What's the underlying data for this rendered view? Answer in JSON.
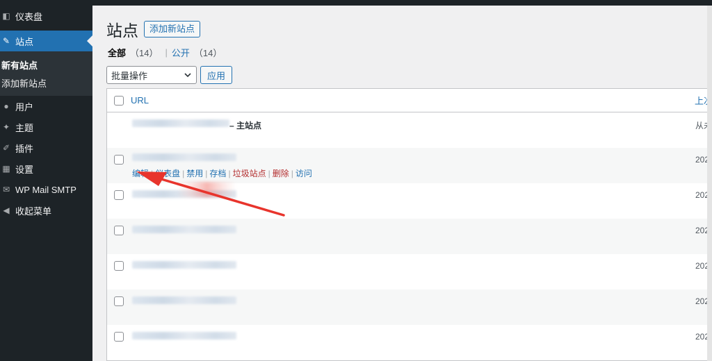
{
  "sidebar": {
    "items": [
      {
        "label": "仪表盘",
        "icon": "dashboard-icon",
        "glyph": "◧"
      },
      {
        "label": "站点",
        "icon": "sites-icon",
        "glyph": "✎"
      },
      {
        "label": "用户",
        "icon": "users-icon",
        "glyph": "●"
      },
      {
        "label": "主题",
        "icon": "themes-icon",
        "glyph": "✦"
      },
      {
        "label": "插件",
        "icon": "plugins-icon",
        "glyph": "✐"
      },
      {
        "label": "设置",
        "icon": "settings-icon",
        "glyph": "▦"
      },
      {
        "label": "WP Mail SMTP",
        "icon": "mail-icon",
        "glyph": "✉"
      },
      {
        "label": "收起菜单",
        "icon": "collapse-icon",
        "glyph": "◀"
      }
    ],
    "submenu": [
      {
        "label": "新有站点"
      },
      {
        "label": "添加新站点"
      }
    ]
  },
  "header": {
    "title": "站点",
    "add_new": "添加新站点"
  },
  "filters": {
    "all": "全部",
    "all_count": "（14）",
    "separator": "|",
    "public": "公开",
    "public_count": "（14）"
  },
  "bulk": {
    "selected": "批量操作",
    "apply": "应用"
  },
  "table": {
    "col_url": "URL",
    "col_last": "上次更新",
    "rows": [
      {
        "label": "– 主站点",
        "date": "从未"
      },
      {
        "date": "202",
        "actions": [
          "编辑",
          "仪表盘",
          "禁用",
          "存档",
          "垃圾站点",
          "删除",
          "访问"
        ]
      },
      {
        "date": "202"
      },
      {
        "date": "202"
      },
      {
        "date": "202"
      },
      {
        "date": "202"
      },
      {
        "date": "202"
      }
    ]
  },
  "colors": {
    "accent": "#2271b1",
    "sidebar_bg": "#1d2327",
    "annotation_arrow": "#e8342c"
  }
}
